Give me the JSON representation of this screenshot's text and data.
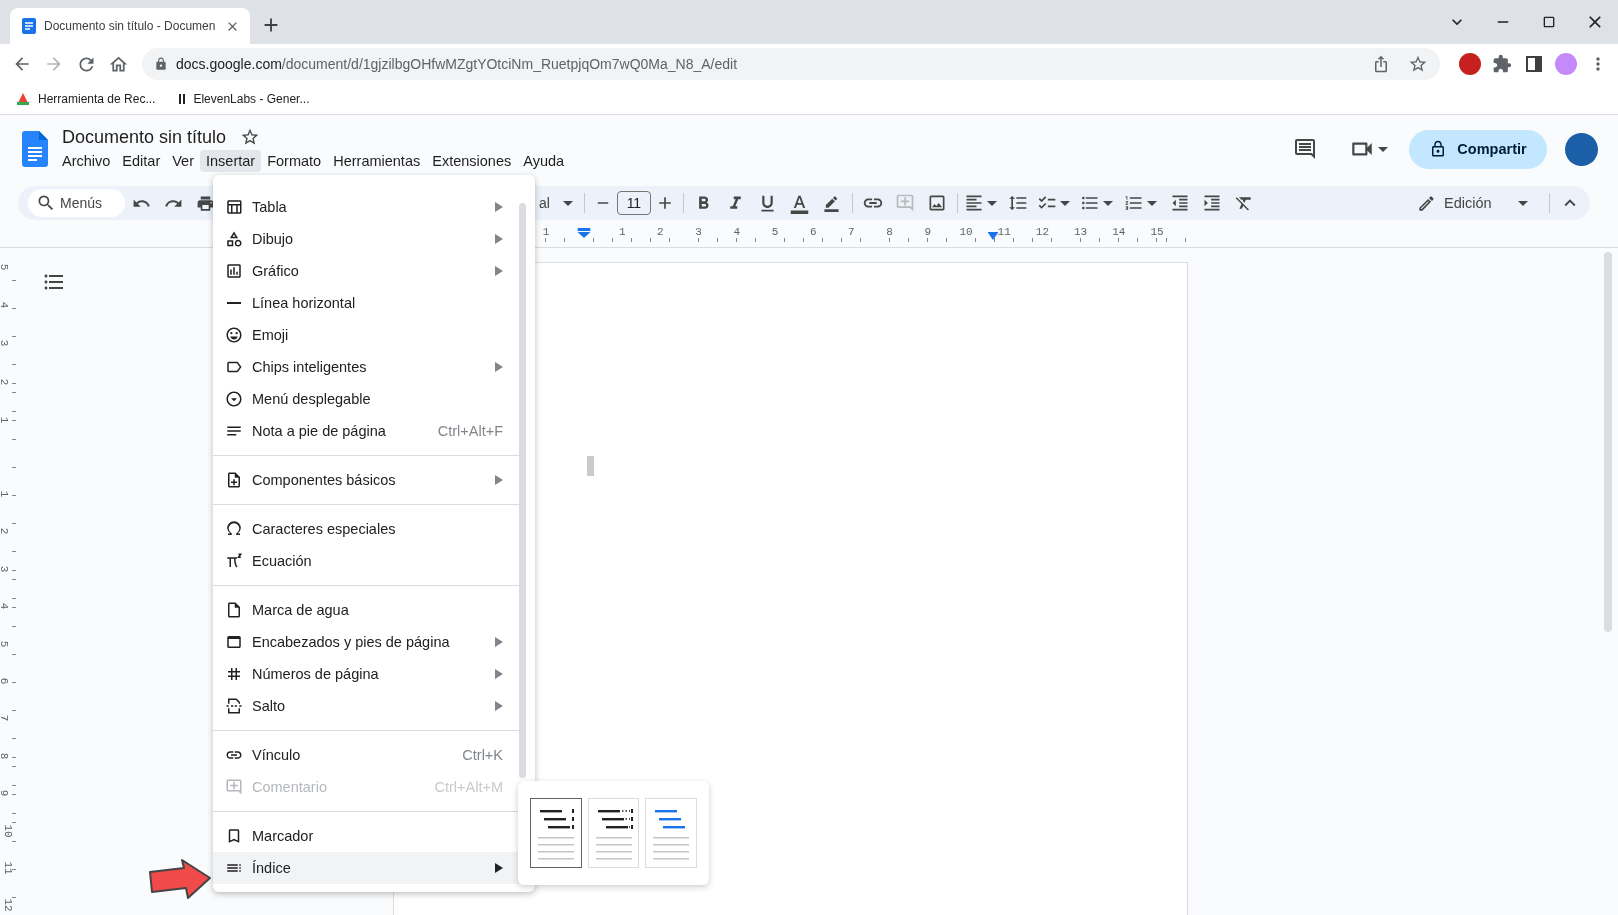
{
  "browser": {
    "tab_title": "Documento sin título - Documen",
    "url": "docs.google.com/document/d/1gjzilbgOHfwMZgtYOtciNm_RuetpjqOm7wQ0Ma_N8_A/edit",
    "bookmarks": [
      "Herramienta de Rec...",
      "ElevenLabs - Gener..."
    ]
  },
  "document": {
    "title": "Documento sin título",
    "menus": [
      {
        "label": "Archivo",
        "selected": false
      },
      {
        "label": "Editar",
        "selected": false
      },
      {
        "label": "Ver",
        "selected": false
      },
      {
        "label": "Insertar",
        "selected": true
      },
      {
        "label": "Formato",
        "selected": false
      },
      {
        "label": "Herramientas",
        "selected": false
      },
      {
        "label": "Extensiones",
        "selected": false
      },
      {
        "label": "Ayuda",
        "selected": false
      }
    ],
    "share_button": "Compartir"
  },
  "toolbar": {
    "search_placeholder": "Menús",
    "font_name": "al",
    "font_size": "11",
    "mode": "Edición"
  },
  "ruler": {
    "left_numbers": [
      "1"
    ],
    "numbers": [
      "1",
      "2",
      "3",
      "4",
      "5",
      "6",
      "7",
      "8",
      "9",
      "10",
      "11",
      "12",
      "13",
      "14",
      "15"
    ],
    "top_numbers": [
      "5",
      "4",
      "3",
      "2",
      "1"
    ],
    "side_numbers": [
      "1",
      "2",
      "3",
      "4",
      "5",
      "6",
      "7",
      "8",
      "9",
      "10",
      "11",
      "12"
    ]
  },
  "insert_menu": {
    "groups": [
      [
        {
          "label": "Tabla",
          "submenu": true,
          "disabled": false,
          "selected": false
        },
        {
          "label": "Dibujo",
          "submenu": true,
          "disabled": false,
          "selected": false
        },
        {
          "label": "Gráfico",
          "submenu": true,
          "disabled": false,
          "selected": false
        },
        {
          "label": "Línea horizontal",
          "submenu": false,
          "disabled": false,
          "selected": false
        },
        {
          "label": "Emoji",
          "submenu": false,
          "disabled": false,
          "selected": false
        },
        {
          "label": "Chips inteligentes",
          "submenu": true,
          "disabled": false,
          "selected": false
        },
        {
          "label": "Menú desplegable",
          "submenu": false,
          "disabled": false,
          "selected": false
        },
        {
          "label": "Nota a pie de página",
          "shortcut": "Ctrl+Alt+F",
          "submenu": false,
          "disabled": false,
          "selected": false
        }
      ],
      [
        {
          "label": "Componentes básicos",
          "submenu": true,
          "disabled": false,
          "selected": false
        }
      ],
      [
        {
          "label": "Caracteres especiales",
          "submenu": false,
          "disabled": false,
          "selected": false
        },
        {
          "label": "Ecuación",
          "submenu": false,
          "disabled": false,
          "selected": false
        }
      ],
      [
        {
          "label": "Marca de agua",
          "submenu": false,
          "disabled": false,
          "selected": false
        },
        {
          "label": "Encabezados y pies de página",
          "submenu": true,
          "disabled": false,
          "selected": false
        },
        {
          "label": "Números de página",
          "submenu": true,
          "disabled": false,
          "selected": false
        },
        {
          "label": "Salto",
          "submenu": true,
          "disabled": false,
          "selected": false
        }
      ],
      [
        {
          "label": "Vínculo",
          "shortcut": "Ctrl+K",
          "submenu": false,
          "disabled": false,
          "selected": false
        },
        {
          "label": "Comentario",
          "shortcut": "Ctrl+Alt+M",
          "submenu": false,
          "disabled": true,
          "selected": false
        }
      ],
      [
        {
          "label": "Marcador",
          "submenu": false,
          "disabled": false,
          "selected": false
        },
        {
          "label": "Índice",
          "submenu": true,
          "disabled": false,
          "selected": true
        }
      ]
    ]
  },
  "toc_submenu": {
    "options": [
      {
        "kind": "numbered",
        "selected": true
      },
      {
        "kind": "dotted",
        "selected": false
      },
      {
        "kind": "linked",
        "selected": false
      }
    ]
  }
}
